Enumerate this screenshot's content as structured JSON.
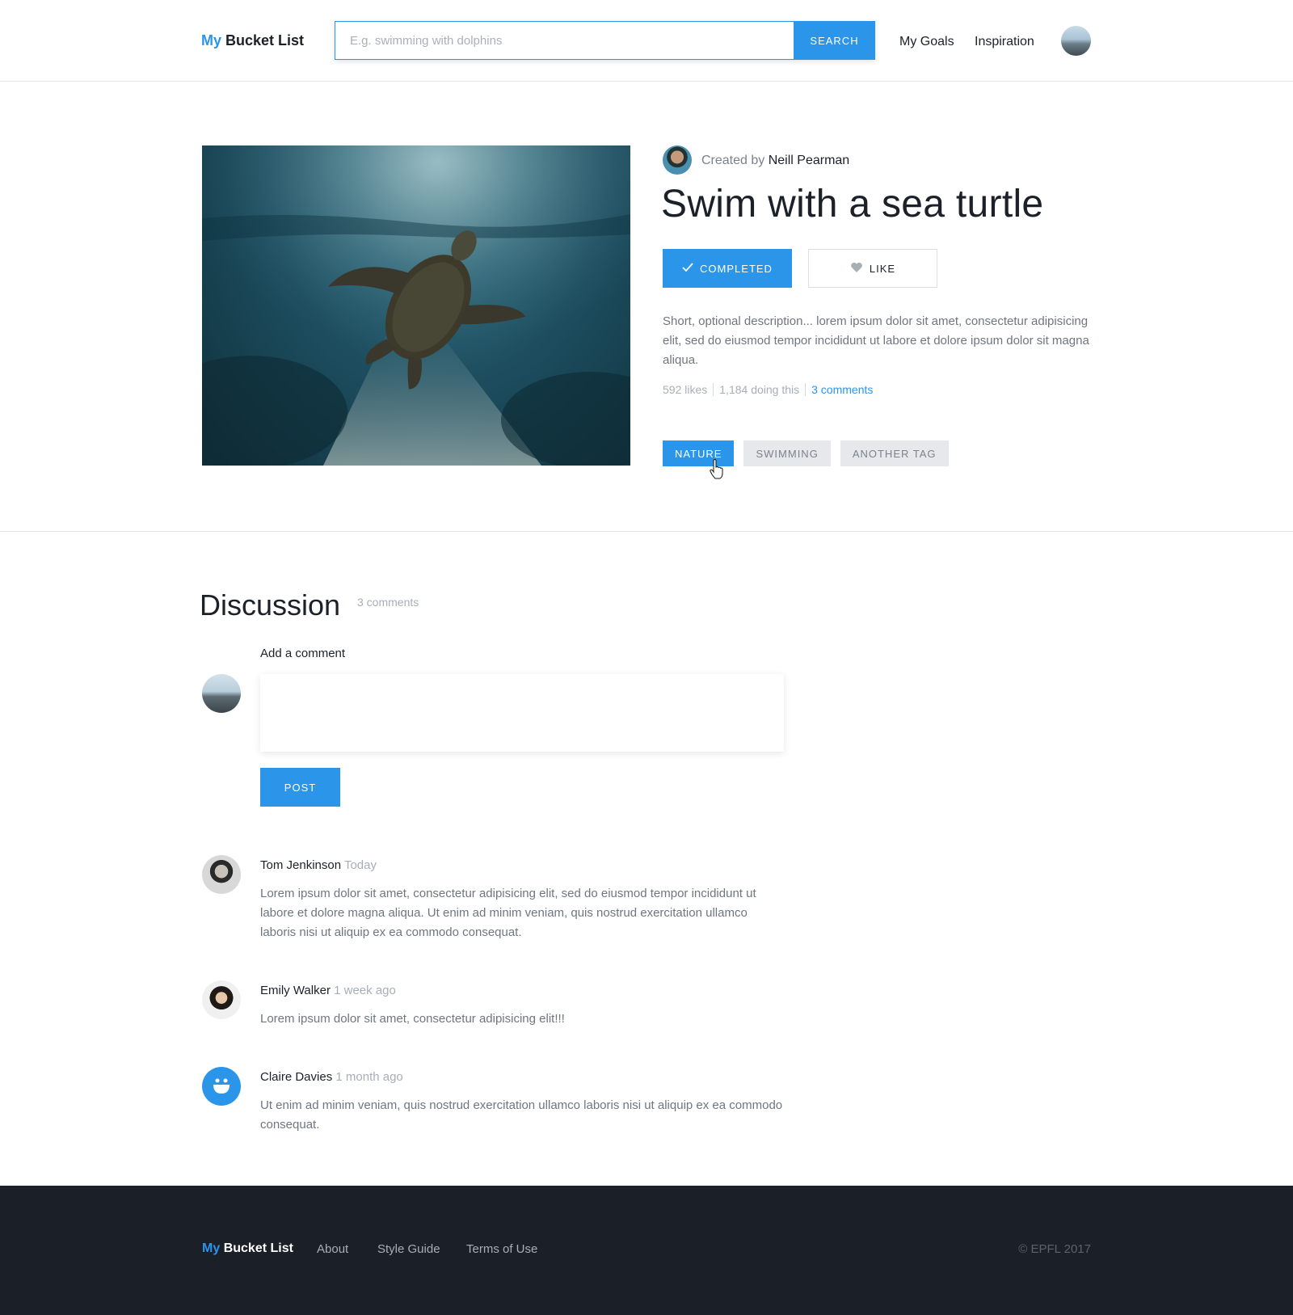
{
  "header": {
    "logo_my": "My",
    "logo_rest": "Bucket List",
    "search_placeholder": "E.g. swimming with dolphins",
    "search_button": "SEARCH",
    "nav": [
      "My Goals",
      "Inspiration"
    ]
  },
  "goal": {
    "created_by_prefix": "Created by",
    "creator": "Neill Pearman",
    "title": "Swim with a sea turtle",
    "completed_label": "COMPLETED",
    "like_label": "LIKE",
    "description": "Short, optional description... lorem ipsum dolor sit amet, consectetur adipisicing elit, sed do eiusmod tempor incididunt ut labore et dolore ipsum dolor sit magna aliqua.",
    "likes": "592 likes",
    "doing": "1,184 doing this",
    "comments_link": "3 comments",
    "tags": [
      "NATURE",
      "SWIMMING",
      "ANOTHER TAG"
    ]
  },
  "discussion": {
    "title": "Discussion",
    "count": "3 comments",
    "add_label": "Add a comment",
    "post_button": "POST",
    "comments": [
      {
        "author": "Tom Jenkinson",
        "time": "Today",
        "text": "Lorem ipsum dolor sit amet, consectetur adipisicing elit, sed do eiusmod tempor incididunt ut labore et dolore magna aliqua. Ut enim ad minim veniam, quis nostrud exercitation ullamco laboris nisi ut aliquip ex ea commodo consequat."
      },
      {
        "author": "Emily Walker",
        "time": "1 week ago",
        "text": "Lorem ipsum dolor sit amet, consectetur adipisicing elit!!!"
      },
      {
        "author": "Claire Davies",
        "time": "1 month ago",
        "text": "Ut enim ad minim veniam, quis nostrud exercitation ullamco laboris nisi ut aliquip ex ea commodo consequat."
      }
    ]
  },
  "footer": {
    "logo_my": "My",
    "logo_rest": "Bucket List",
    "links": [
      "About",
      "Style Guide",
      "Terms of Use"
    ],
    "copyright": "© EPFL 2017"
  },
  "colors": {
    "accent": "#2b95ea",
    "text": "#1c2129",
    "muted": "#a8aeb6",
    "footer_bg": "#1b2028"
  },
  "icons": [
    "check-icon",
    "heart-icon",
    "hand-cursor-icon",
    "smiley-icon"
  ]
}
